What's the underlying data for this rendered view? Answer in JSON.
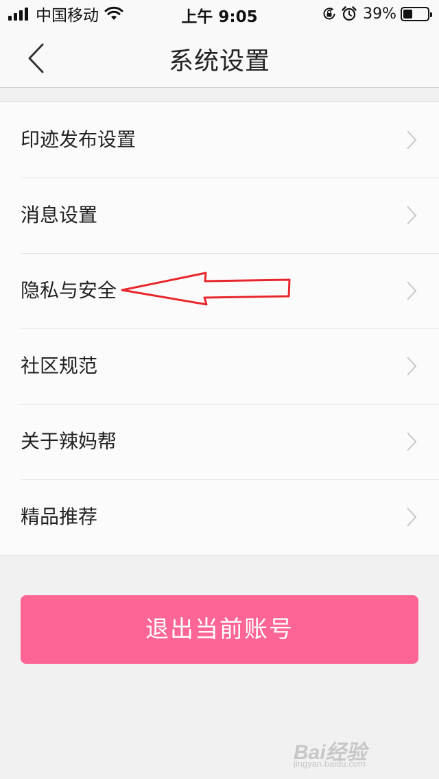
{
  "status_bar": {
    "carrier": "中国移动",
    "time": "上午 9:05",
    "battery": "39%",
    "battery_level": 0.39,
    "icons": [
      "signal-icon",
      "wifi-icon",
      "orientation-lock-icon",
      "alarm-icon",
      "battery-icon"
    ]
  },
  "nav": {
    "title": "系统设置",
    "back_icon": "chevron-left-icon"
  },
  "settings": {
    "items": [
      {
        "label": "印迹发布设置"
      },
      {
        "label": "消息设置"
      },
      {
        "label": "隐私与安全"
      },
      {
        "label": "社区规范"
      },
      {
        "label": "关于辣妈帮"
      },
      {
        "label": "精品推荐"
      }
    ]
  },
  "logout": {
    "label": "退出当前账号"
  },
  "colors": {
    "accent": "#fd6594",
    "annotation": "#e8262b",
    "background": "#f1f1f1"
  },
  "watermark": {
    "text": "Bai经验",
    "sub": "jingyan.baidu.com"
  }
}
